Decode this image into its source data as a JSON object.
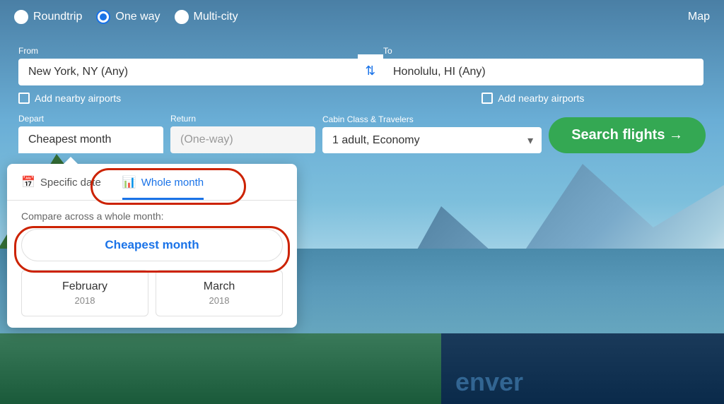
{
  "background": {
    "city_text": "enver"
  },
  "header": {
    "trip_types": [
      {
        "label": "Roundtrip",
        "value": "roundtrip",
        "selected": false
      },
      {
        "label": "One way",
        "value": "oneway",
        "selected": true
      },
      {
        "label": "Multi-city",
        "value": "multicity",
        "selected": false
      }
    ],
    "map_label": "Map"
  },
  "search": {
    "from_label": "From",
    "from_value": "New York, NY (Any)",
    "to_label": "To",
    "to_value": "Honolulu, HI (Any)",
    "swap_icon": "⇄",
    "nearby_left_label": "Add nearby airports",
    "nearby_right_label": "Add nearby airports",
    "depart_label": "Depart",
    "depart_value": "Cheapest month",
    "return_label": "Return",
    "return_value": "(One-way)",
    "cabin_label": "Cabin Class & Travelers",
    "cabin_value": "1 adult, Economy",
    "search_btn_label": "Search flights →"
  },
  "dropdown": {
    "tabs": [
      {
        "label": "Specific date",
        "icon": "📅",
        "active": false
      },
      {
        "label": "Whole month",
        "icon": "📊",
        "active": true
      }
    ],
    "compare_text": "Compare across a whole month:",
    "cheapest_option": "Cheapest month",
    "months": [
      {
        "name": "February",
        "year": "2018"
      },
      {
        "name": "March",
        "year": "2018"
      }
    ]
  }
}
